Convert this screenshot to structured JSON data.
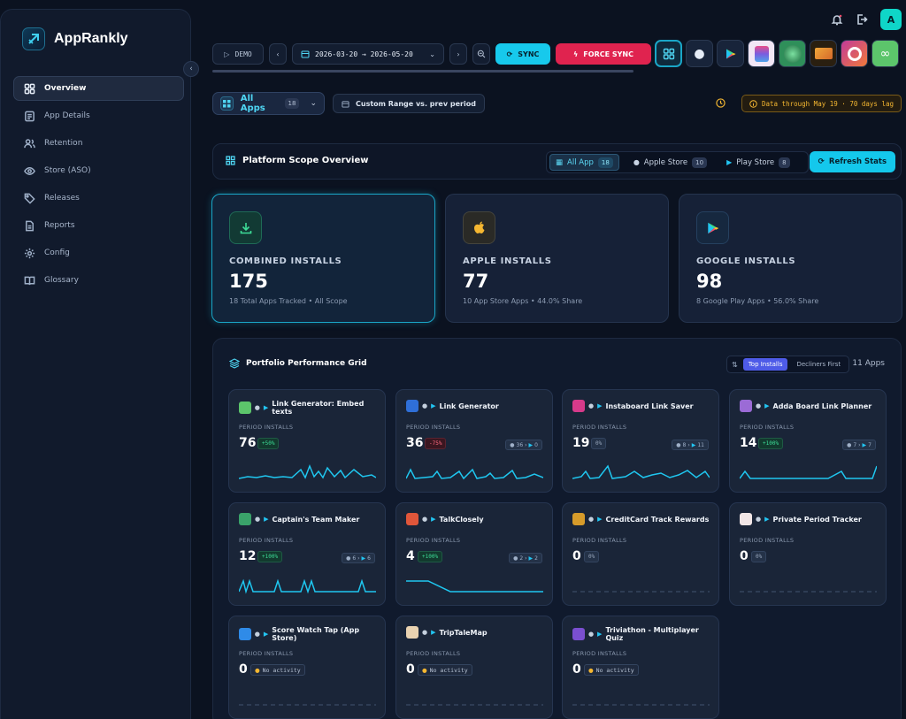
{
  "app": {
    "name": "AppRankly"
  },
  "nav": [
    {
      "label": "Overview",
      "icon": "grid-icon",
      "active": true
    },
    {
      "label": "App Details",
      "icon": "document-icon"
    },
    {
      "label": "Retention",
      "icon": "users-icon"
    },
    {
      "label": "Store (ASO)",
      "icon": "eye-icon"
    },
    {
      "label": "Releases",
      "icon": "tag-icon"
    },
    {
      "label": "Reports",
      "icon": "file-icon"
    },
    {
      "label": "Config",
      "icon": "gear-icon"
    },
    {
      "label": "Glossary",
      "icon": "book-icon"
    }
  ],
  "user": {
    "initial": "A"
  },
  "toolbar": {
    "demo": "DEMO",
    "date_range": "2026-03-20 → 2026-05-20",
    "sync": "SYNC",
    "force_sync": "FORCE SYNC"
  },
  "filter": {
    "all_apps": "All Apps",
    "all_apps_count": "18",
    "range_label": "Custom Range vs. prev period",
    "lag_label": "Data through May 19 · 70 days lag"
  },
  "scope": {
    "title": "Platform Scope Overview",
    "tabs": [
      {
        "label": "All App",
        "count": "18"
      },
      {
        "label": "Apple Store",
        "count": "10"
      },
      {
        "label": "Play Store",
        "count": "8"
      }
    ],
    "refresh": "Refresh Stats"
  },
  "kpis": [
    {
      "label": "COMBINED INSTALLS",
      "value": "175",
      "sub": "18 Total Apps Tracked • All Scope"
    },
    {
      "label": "APPLE INSTALLS",
      "value": "77",
      "sub": "10 App Store Apps • 44.0% Share"
    },
    {
      "label": "GOOGLE INSTALLS",
      "value": "98",
      "sub": "8 Google Play Apps • 56.0% Share"
    }
  ],
  "grid": {
    "title": "Portfolio Performance Grid",
    "sort_top": "Top Installs",
    "sort_decliners": "Decliners First",
    "count": "11 Apps",
    "period_label": "PERIOD INSTALLS",
    "cards": [
      {
        "name": "Link Generator: Embed texts",
        "value": "76",
        "change": "+50%",
        "kind": "pos",
        "split": "",
        "color": "#5cc56b"
      },
      {
        "name": "Link Generator",
        "value": "36",
        "change": "-75%",
        "kind": "neg",
        "split_apple": "36",
        "split_play": "0",
        "color": "#2f6fd8"
      },
      {
        "name": "Instaboard Link Saver",
        "value": "19",
        "change": "0%",
        "kind": "neu",
        "split_apple": "8",
        "split_play": "11",
        "color": "#d63a8a"
      },
      {
        "name": "Adda Board Link Planner",
        "value": "14",
        "change": "+100%",
        "kind": "pos",
        "split_apple": "7",
        "split_play": "7",
        "color": "#9b6bd6"
      },
      {
        "name": "Captain's Team Maker",
        "value": "12",
        "change": "+100%",
        "kind": "pos",
        "split_apple": "6",
        "split_play": "6",
        "color": "#3aa36a"
      },
      {
        "name": "TalkClosely",
        "value": "4",
        "change": "+100%",
        "kind": "pos",
        "split_apple": "2",
        "split_play": "2",
        "color": "#e0563a"
      },
      {
        "name": "CreditCard Track Rewards",
        "value": "0",
        "change": "0%",
        "kind": "neu",
        "color": "#d69b2a"
      },
      {
        "name": "Private Period Tracker",
        "value": "0",
        "change": "0%",
        "kind": "neu",
        "color": "#f1e6e6"
      },
      {
        "name": "Score Watch Tap (App Store)",
        "value": "0",
        "change": "No activity",
        "kind": "noact",
        "color": "#2f8be8"
      },
      {
        "name": "TripTaleMap",
        "value": "0",
        "change": "No activity",
        "kind": "noact",
        "color": "#e9d2b0"
      },
      {
        "name": "Triviathon - Multiplayer Quiz",
        "value": "0",
        "change": "No activity",
        "kind": "noact",
        "color": "#7a4fd0"
      }
    ]
  }
}
